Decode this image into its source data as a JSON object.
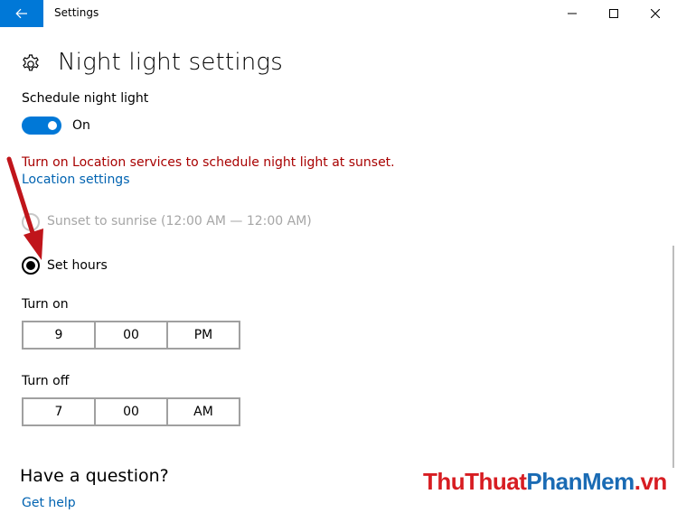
{
  "window": {
    "title": "Settings",
    "back_icon": "back-arrow-icon",
    "minimize_icon": "minimize-icon",
    "maximize_icon": "maximize-icon",
    "close_icon": "close-icon"
  },
  "page": {
    "title": "Night light settings",
    "icon": "gear-icon"
  },
  "schedule": {
    "label": "Schedule night light",
    "toggle_state": "On",
    "toggle_on": true
  },
  "location": {
    "warning": "Turn on Location services to schedule night light at sunset.",
    "link": "Location settings"
  },
  "options": {
    "sunset_label": "Sunset to sunrise (12:00 AM — 12:00 AM)",
    "sunset_disabled": true,
    "set_hours_label": "Set hours",
    "selected": "Set hours"
  },
  "turn_on": {
    "label": "Turn on",
    "hour": "9",
    "minute": "00",
    "period": "PM"
  },
  "turn_off": {
    "label": "Turn off",
    "hour": "7",
    "minute": "00",
    "period": "AM"
  },
  "help": {
    "heading": "Have a question?",
    "link": "Get help"
  },
  "watermark": {
    "part1": "ThuThuat",
    "part2": "PhanMem",
    "part3": ".vn"
  },
  "colors": {
    "accent": "#0078d7",
    "warning": "#a80000",
    "link": "#0063b1",
    "annotation_arrow": "#c0151b"
  }
}
